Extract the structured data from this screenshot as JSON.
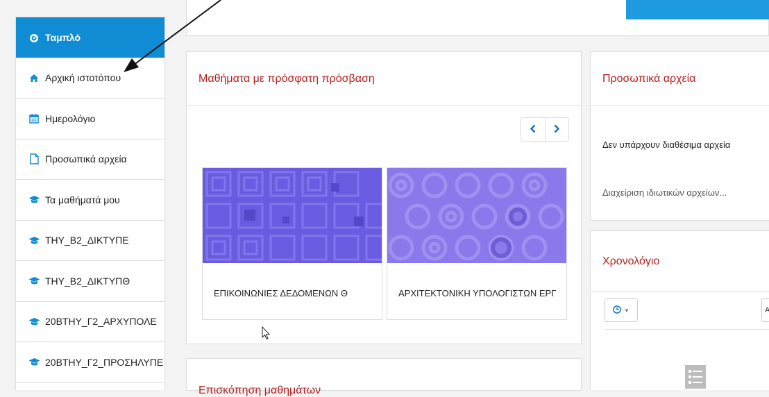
{
  "sidebar": {
    "items": [
      {
        "label": "Ταμπλό",
        "icon": "dashboard-icon"
      },
      {
        "label": "Αρχική ιστοτόπου",
        "icon": "home-icon"
      },
      {
        "label": "Ημερολόγιο",
        "icon": "calendar-icon"
      },
      {
        "label": "Προσωπικά αρχεία",
        "icon": "file-icon"
      },
      {
        "label": "Τα μαθήματά μου",
        "icon": "graduation-cap-icon"
      },
      {
        "label": "ΤΗΥ_Β2_ΔΙΚΤΥΠΕ",
        "icon": "graduation-cap-icon"
      },
      {
        "label": "ΤΗΥ_Β2_ΔΙΚΤΥΠΘ",
        "icon": "graduation-cap-icon"
      },
      {
        "label": "20ΒΤΗΥ_Γ2_ΑΡΧΥΠΟΛΕ",
        "icon": "graduation-cap-icon"
      },
      {
        "label": "20ΒΤΗΥ_Γ2_ΠΡΟΣΗΛΥΠΕ",
        "icon": "graduation-cap-icon"
      }
    ],
    "active_index": 0
  },
  "recent_courses": {
    "title": "Μαθήματα με πρόσφατη πρόσβαση",
    "prev_icon": "chevron-left-icon",
    "next_icon": "chevron-right-icon",
    "courses": [
      {
        "name": "ΕΠΙΚΟΙΝΩΝΙΕΣ ΔΕΔΟΜΕΝΩΝ Θ",
        "pattern": "squares",
        "color": "#6a5ce0"
      },
      {
        "name": "ΑΡΧΙΤΕΚΤΟΝΙΚΗ ΥΠΟΛΟΓΙΣΤΩΝ ΕΡΓ",
        "pattern": "circles",
        "color": "#8b78ea"
      }
    ]
  },
  "private_files": {
    "title": "Προσωπικά αρχεία",
    "empty_text": "Δεν υπάρχουν διαθέσιμα αρχεία",
    "manage_link": "Διαχείριση ιδιωτικών αρχείων..."
  },
  "timeline": {
    "title": "Χρονολόγιο",
    "filter_icon": "clock-icon",
    "sort_label": "Α",
    "empty_icon": "list-icon"
  },
  "course_overview": {
    "title": "Επισκόπηση μαθημάτων"
  },
  "colors": {
    "accent": "#0f8cd3",
    "header_red": "#b52020"
  }
}
